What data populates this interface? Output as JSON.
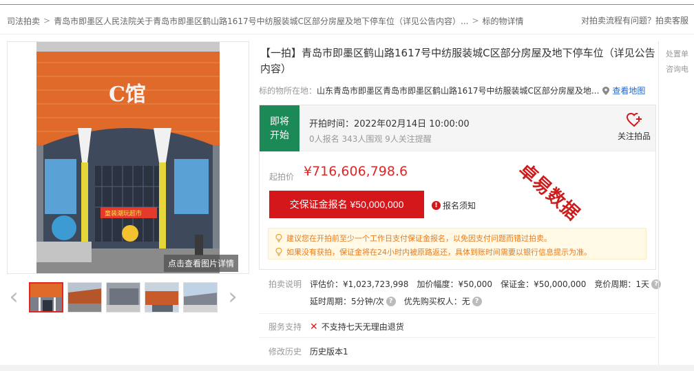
{
  "breadcrumb": {
    "items": [
      "司法拍卖",
      "青岛市即墨区人民法院关于青岛市即墨区鹤山路1617号中纺服装城C区部分房屋及地下停车位（详见公告内容）...",
      "标的物详情"
    ],
    "separator": ">"
  },
  "top_right": {
    "text": "对拍卖流程有问题？拍卖客服"
  },
  "gallery": {
    "building_sign": "C馆",
    "store_sign": "童装潮玩超市",
    "caption": "点击查看图片详情",
    "prev_arrow": "‹",
    "next_arrow": "›"
  },
  "title": "【一拍】青岛市即墨区鹤山路1617号中纺服装城C区部分房屋及地下停车位（详见公告内容）",
  "location": {
    "label": "标的物所在地：",
    "value": "山东青岛市即墨区青岛市即墨区鹤山路1617号中纺服装城C区部分房屋及地...",
    "map_link": "查看地图"
  },
  "status": {
    "tag_line1": "即将",
    "tag_line2": "开始",
    "start_time": "开拍时间：2022年02月14日 10:00:00",
    "counts": "0人报名  343人围观  9人关注提醒",
    "follow_label": "关注拍品"
  },
  "pricing": {
    "start_label": "起拍价",
    "start_price": "¥716,606,798.6",
    "deposit_button": "交保证金报名 ¥50,000,000",
    "notice": "报名须知",
    "watermark": "卓易数据"
  },
  "tips": [
    "建议您在开拍前至少一个工作日支付保证金报名，以免因支付问题而错过拍卖。",
    "如果没有获拍，保证金将在24小时内被原路返还，具体到账时间需要以银行信息提示为准。"
  ],
  "details": {
    "label": "拍卖说明",
    "appraisal": "评估价：¥1,023,723,998",
    "increment": "加价幅度：¥50,000",
    "deposit": "保证金：¥50,000,000",
    "bid_cycle": "竞价周期：1天",
    "delay_cycle": "延时周期：5分钟/次",
    "priority": "优先购买权人：无"
  },
  "service": {
    "label": "服务支持",
    "value": "不支持七天无理由退货"
  },
  "history": {
    "label": "修改历史",
    "value": "历史版本1"
  },
  "sidebar": {
    "line1": "处置单",
    "line2": "咨询电"
  },
  "colors": {
    "brand_red": "#d4171b",
    "status_green": "#1b8a57",
    "tip_orange": "#e87b1e",
    "link_blue": "#2266cc"
  }
}
